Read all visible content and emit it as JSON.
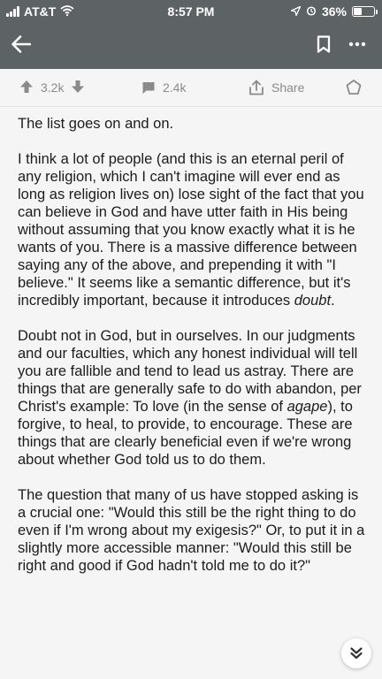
{
  "status_bar": {
    "carrier": "AT&T",
    "time": "8:57 PM",
    "battery_percent": "36%",
    "battery_level": 0.36
  },
  "nav": {
    "back_icon": "arrow-left-icon",
    "bookmark_icon": "bookmark-icon",
    "more_icon": "more-dots-icon"
  },
  "actions": {
    "upvotes": "3.2k",
    "comments": "2.4k",
    "share_label": "Share"
  },
  "post": {
    "p1": "The list goes on and on.",
    "p2_main": "I think a lot of people (and this is an eternal peril of any religion, which I can't imagine will ever end as long as religion lives on) lose sight of the fact that you can believe in God and have utter faith in His being without assuming that you know exactly what it is he wants of you. There is a massive difference between saying any of the above, and prepending it with \"I believe.\" It seems like a semantic difference, but it's incredibly important, because it introduces ",
    "p2_em": "doubt",
    "p2_end": ".",
    "p3_main": "Doubt not in God, but in ourselves. In our judgments and our faculties, which any honest individual will tell you are fallible and tend to lead us astray. There are things that are generally safe to do with abandon, per Christ's example: To love (in the sense of ",
    "p3_em": "agape",
    "p3_end": "), to forgive, to heal, to provide, to encourage. These are things that are clearly beneficial even if we're wrong about whether God told us to do them.",
    "p4": "The question that many of us have stopped asking is a crucial one: \"Would this still be the right thing to do even if I'm wrong about my exigesis?\" Or, to put it in a slightly more accessible manner: \"Would this still be right and good if God hadn't told me to do it?\""
  },
  "colors": {
    "header_bg": "#5d6264",
    "page_bg": "#f5f5f5",
    "action_gray": "#8a8a8a"
  }
}
